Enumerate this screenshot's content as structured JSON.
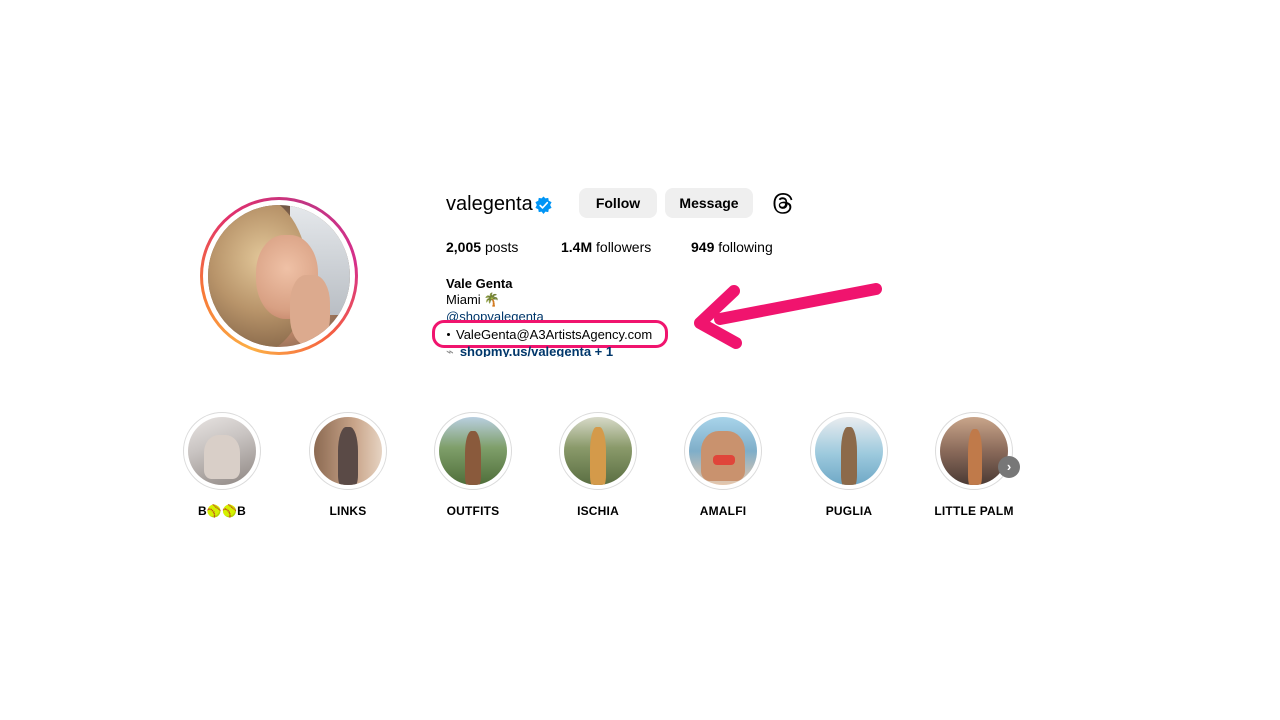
{
  "profile": {
    "username": "valegenta",
    "verified": true,
    "follow_label": "Follow",
    "message_label": "Message",
    "threads_icon": "threads-icon"
  },
  "stats": {
    "posts_count": "2,005",
    "posts_label": "posts",
    "followers_count": "1.4M",
    "followers_label": "followers",
    "following_count": "949",
    "following_label": "following"
  },
  "bio": {
    "full_name": "Vale Genta",
    "city": "Miami",
    "city_emoji": "🌴",
    "mention": "@shopvalegenta",
    "email": "ValeGenta@A3ArtistsAgency.com",
    "link": "shopmy.us/valegenta + 1"
  },
  "annotation": {
    "highlight_color": "#f0146e"
  },
  "highlights": [
    {
      "label": "B🥎🥎B",
      "bg": "#c9c4c2"
    },
    {
      "label": "LINKS",
      "bg": "#b48a70"
    },
    {
      "label": "OUTFITS",
      "bg": "#6f8a5a"
    },
    {
      "label": "ISCHIA",
      "bg": "#8a9a6a"
    },
    {
      "label": "AMALFI",
      "bg": "#7faec9"
    },
    {
      "label": "PUGLIA",
      "bg": "#9cb6c2"
    },
    {
      "label": "LITTLE PALM",
      "bg": "#a07a66"
    }
  ],
  "colors": {
    "accent_link": "#00376b",
    "button_bg": "#efefef",
    "verified_blue": "#0095f6"
  }
}
